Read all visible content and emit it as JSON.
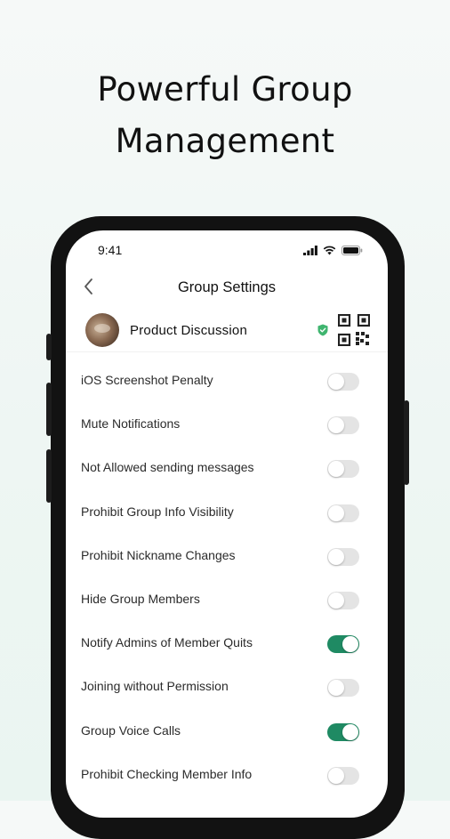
{
  "headline": {
    "line1": "Powerful Group",
    "line2": "Management"
  },
  "status_bar": {
    "time": "9:41"
  },
  "nav": {
    "title": "Group Settings"
  },
  "group": {
    "name": "Product Discussion"
  },
  "colors": {
    "accent": "#1f8a63",
    "toggle_off": "#e4e4e4",
    "shield": "#3fb56f"
  },
  "settings": [
    {
      "label": "iOS Screenshot Penalty",
      "on": false
    },
    {
      "label": "Mute Notifications",
      "on": false
    },
    {
      "label": "Not Allowed sending messages",
      "on": false
    },
    {
      "label": "Prohibit Group Info Visibility",
      "on": false
    },
    {
      "label": "Prohibit Nickname Changes",
      "on": false
    },
    {
      "label": "Hide Group Members",
      "on": false
    },
    {
      "label": "Notify Admins of Member Quits",
      "on": true
    },
    {
      "label": "Joining without Permission",
      "on": false
    },
    {
      "label": "Group Voice Calls",
      "on": true
    },
    {
      "label": "Prohibit Checking Member Info",
      "on": false
    }
  ]
}
